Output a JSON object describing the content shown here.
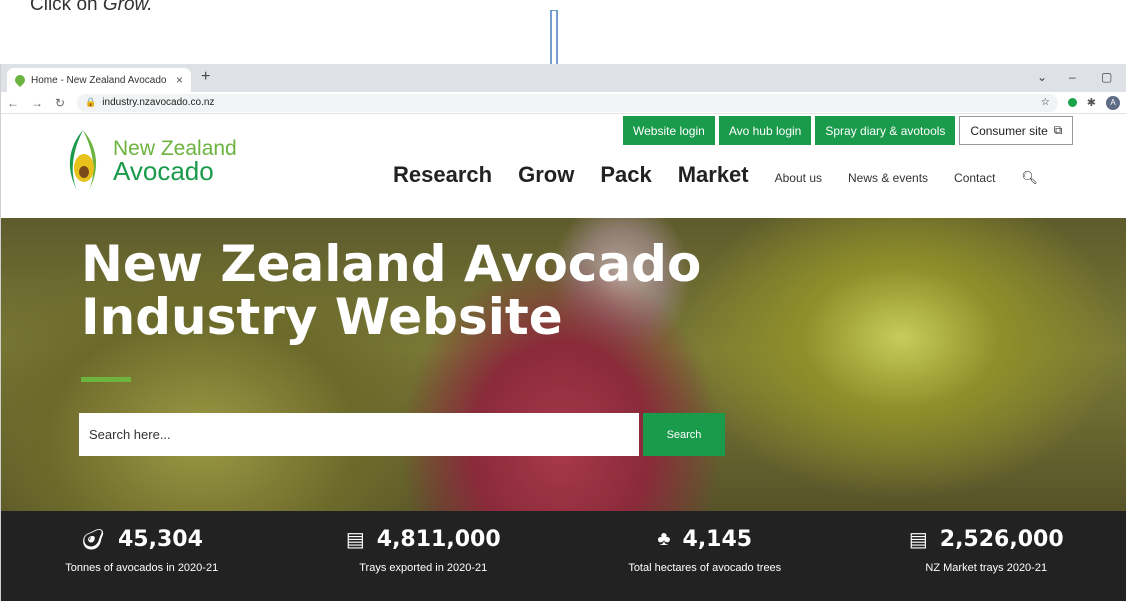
{
  "instruction": {
    "prefix": "Click on ",
    "target": "Grow."
  },
  "browser": {
    "tab_title": "Home - New Zealand Avocado",
    "tab_close": "×",
    "new_tab": "+",
    "url": "industry.nzavocado.co.nz",
    "avatar_letter": "A"
  },
  "site": {
    "logo_line1": "New Zealand",
    "logo_line2": "Avocado",
    "top_buttons": [
      "Website login",
      "Avo hub login",
      "Spray diary & avotools",
      "Consumer site"
    ],
    "nav_main": [
      "Research",
      "Grow",
      "Pack",
      "Market"
    ],
    "nav_secondary": [
      "About us",
      "News & events",
      "Contact"
    ]
  },
  "hero": {
    "title_line1": "New Zealand Avocado",
    "title_line2": "Industry Website",
    "search_placeholder": "Search here...",
    "search_button": "Search"
  },
  "stats": [
    {
      "icon": "avocado-icon",
      "value": "45,304",
      "label": "Tonnes of avocados in 2020-21"
    },
    {
      "icon": "tray-icon",
      "value": "4,811,000",
      "label": "Trays exported in 2020-21"
    },
    {
      "icon": "tree-icon",
      "value": "4,145",
      "label": "Total hectares of avocado trees"
    },
    {
      "icon": "tray-icon",
      "value": "2,526,000",
      "label": "NZ Market trays 2020-21"
    }
  ],
  "colors": {
    "brand_green": "#1a9a4b",
    "logo_green": "#6cb33f",
    "stats_bg": "#222222",
    "arrow": "#4a7fc1"
  }
}
